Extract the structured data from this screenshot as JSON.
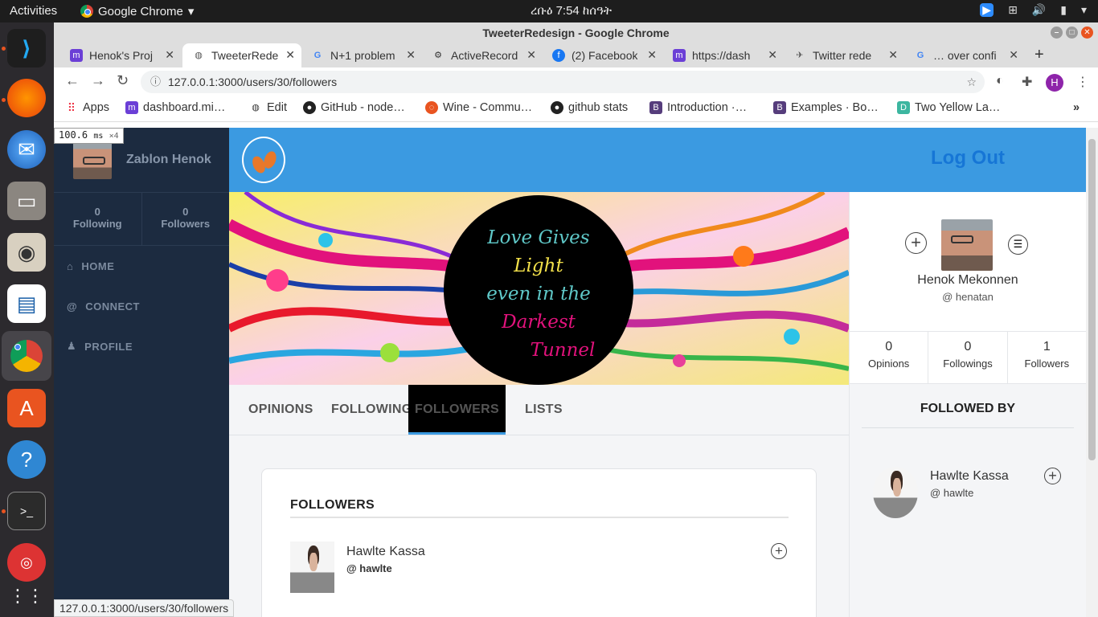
{
  "topbar": {
    "activities": "Activities",
    "app_name": "Google Chrome",
    "clock": "ረቡዕ  7:54 ከሰዓት"
  },
  "window": {
    "title": "TweeterRedesign - Google Chrome"
  },
  "tabs": [
    {
      "title": "Henok's Proj"
    },
    {
      "title": "TweeterRede"
    },
    {
      "title": "N+1 problem"
    },
    {
      "title": "ActiveRecord"
    },
    {
      "title": "(2) Facebook"
    },
    {
      "title": "https://dash"
    },
    {
      "title": "Twitter rede"
    },
    {
      "title": "… over confi"
    }
  ],
  "address": {
    "url": "127.0.0.1:3000/users/30/followers",
    "profile_initial": "H"
  },
  "bookmarks": [
    {
      "label": "Apps"
    },
    {
      "label": "dashboard.mi…"
    },
    {
      "label": "Edit"
    },
    {
      "label": "GitHub - node…"
    },
    {
      "label": "Wine - Commu…"
    },
    {
      "label": "github stats"
    },
    {
      "label": "Introduction ·…"
    },
    {
      "label": "Examples · Bo…"
    },
    {
      "label": "Two Yellow La…"
    }
  ],
  "perf_overlay": {
    "ms": "100.6",
    "unit": "ms",
    "mult": "×4"
  },
  "sidebar": {
    "user_name": "Zablon Henok",
    "following_count": "0",
    "following_label": "Following",
    "followers_count": "0",
    "followers_label": "Followers",
    "nav": [
      {
        "label": "HOME"
      },
      {
        "label": "CONNECT"
      },
      {
        "label": "PROFILE"
      }
    ]
  },
  "header": {
    "logout": "Log Out"
  },
  "banner": {
    "line1": "Love Gives",
    "line2": "Light",
    "line3": "even in the",
    "line4": "Darkest",
    "line5": "Tunnel"
  },
  "profile_tabs": [
    {
      "label": "OPINIONS"
    },
    {
      "label": "FOLLOWING"
    },
    {
      "label": "FOLLOWERS"
    },
    {
      "label": "LISTS"
    }
  ],
  "followers_card": {
    "heading": "FOLLOWERS",
    "items": [
      {
        "name": "Hawlte Kassa",
        "handle": "@ hawlte"
      }
    ]
  },
  "profile_panel": {
    "name": "Henok Mekonnen",
    "handle": "@ henatan",
    "stats": [
      {
        "count": "0",
        "label": "Opinions"
      },
      {
        "count": "0",
        "label": "Followings"
      },
      {
        "count": "1",
        "label": "Followers"
      }
    ],
    "followed_by_heading": "FOLLOWED BY",
    "followed_by": [
      {
        "name": "Hawlte Kassa",
        "handle": "@ hawlte"
      }
    ]
  },
  "statusbar": {
    "url": "127.0.0.1:3000/users/30/followers"
  }
}
